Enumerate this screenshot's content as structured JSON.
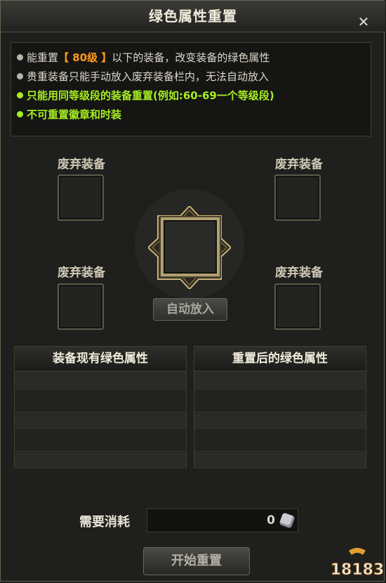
{
  "window": {
    "title": "绿色属性重置",
    "close_icon": "close-icon"
  },
  "info": {
    "line1_prefix": "能重置",
    "line1_level": "【 80级 】",
    "line1_suffix": "以下的装备，改变装备的绿色属性",
    "line2": "贵重装备只能手动放入废弃装备栏内，无法自动放入",
    "line3": "只能用同等级段的装备重置(例如:60-69一个等级段)",
    "line4": "不可重置徽章和时装"
  },
  "slots": {
    "top_left_label": "废弃装备",
    "top_right_label": "废弃装备",
    "bottom_left_label": "废弃装备",
    "bottom_right_label": "废弃装备"
  },
  "auto_button": "自动放入",
  "tables": {
    "current_header": "装备现有绿色属性",
    "after_header": "重置后的绿色属性"
  },
  "cost": {
    "label": "需要消耗",
    "value": "0",
    "icon": "dice-icon"
  },
  "start_button": "开始重置",
  "watermark": "18183",
  "colors": {
    "green_text": "#a6ee22",
    "orange_text": "#ff9a1a",
    "gray_text": "#dcd8cc"
  }
}
